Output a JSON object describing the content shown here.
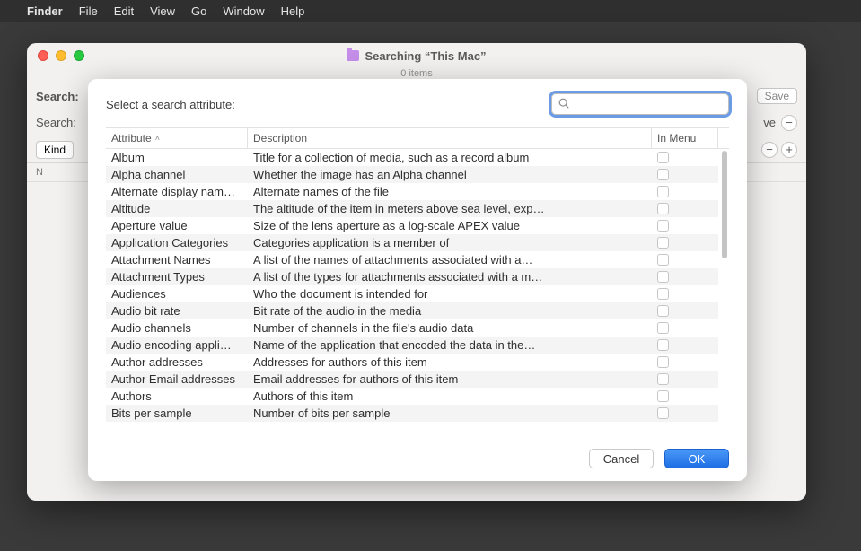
{
  "menubar": {
    "apple_glyph": "",
    "app": "Finder",
    "items": [
      "File",
      "Edit",
      "View",
      "Go",
      "Window",
      "Help"
    ]
  },
  "finder": {
    "title": "Searching “This Mac”",
    "subcount": "0 items",
    "searchbar_label": "Search:",
    "search_label2": "Search:",
    "save_label": "Save",
    "kind_label": "Kind",
    "name_col": "N",
    "sve_partial": "ve"
  },
  "dialog": {
    "title": "Select a search attribute:",
    "search_placeholder": "",
    "columns": {
      "attribute": "Attribute",
      "description": "Description",
      "inmenu": "In Menu"
    },
    "buttons": {
      "cancel": "Cancel",
      "ok": "OK"
    },
    "rows": [
      {
        "attr": "Album",
        "desc": "Title for a collection of media, such as a record album",
        "inmenu": false
      },
      {
        "attr": "Alpha channel",
        "desc": "Whether the image has an Alpha channel",
        "inmenu": false
      },
      {
        "attr": "Alternate display nam…",
        "desc": "Alternate names of the file",
        "inmenu": false
      },
      {
        "attr": "Altitude",
        "desc": "The altitude of the item in meters above sea level, exp…",
        "inmenu": false
      },
      {
        "attr": "Aperture value",
        "desc": "Size of the lens aperture as a log-scale APEX value",
        "inmenu": false
      },
      {
        "attr": "Application Categories",
        "desc": "Categories application is a member of",
        "inmenu": false
      },
      {
        "attr": "Attachment Names",
        "desc": "A list of the names of attachments associated with a…",
        "inmenu": false
      },
      {
        "attr": "Attachment Types",
        "desc": "A list of the types for attachments associated with a m…",
        "inmenu": false
      },
      {
        "attr": "Audiences",
        "desc": "Who the document is intended for",
        "inmenu": false
      },
      {
        "attr": "Audio bit rate",
        "desc": "Bit rate of the audio in the media",
        "inmenu": false
      },
      {
        "attr": "Audio channels",
        "desc": "Number of channels in the file's audio data",
        "inmenu": false
      },
      {
        "attr": "Audio encoding appli…",
        "desc": "Name of the application that encoded the data in the…",
        "inmenu": false
      },
      {
        "attr": "Author addresses",
        "desc": "Addresses for authors of this item",
        "inmenu": false
      },
      {
        "attr": "Author Email addresses",
        "desc": "Email addresses for authors of this item",
        "inmenu": false
      },
      {
        "attr": "Authors",
        "desc": "Authors of this item",
        "inmenu": false
      },
      {
        "attr": "Bits per sample",
        "desc": "Number of bits per sample",
        "inmenu": false
      }
    ]
  }
}
